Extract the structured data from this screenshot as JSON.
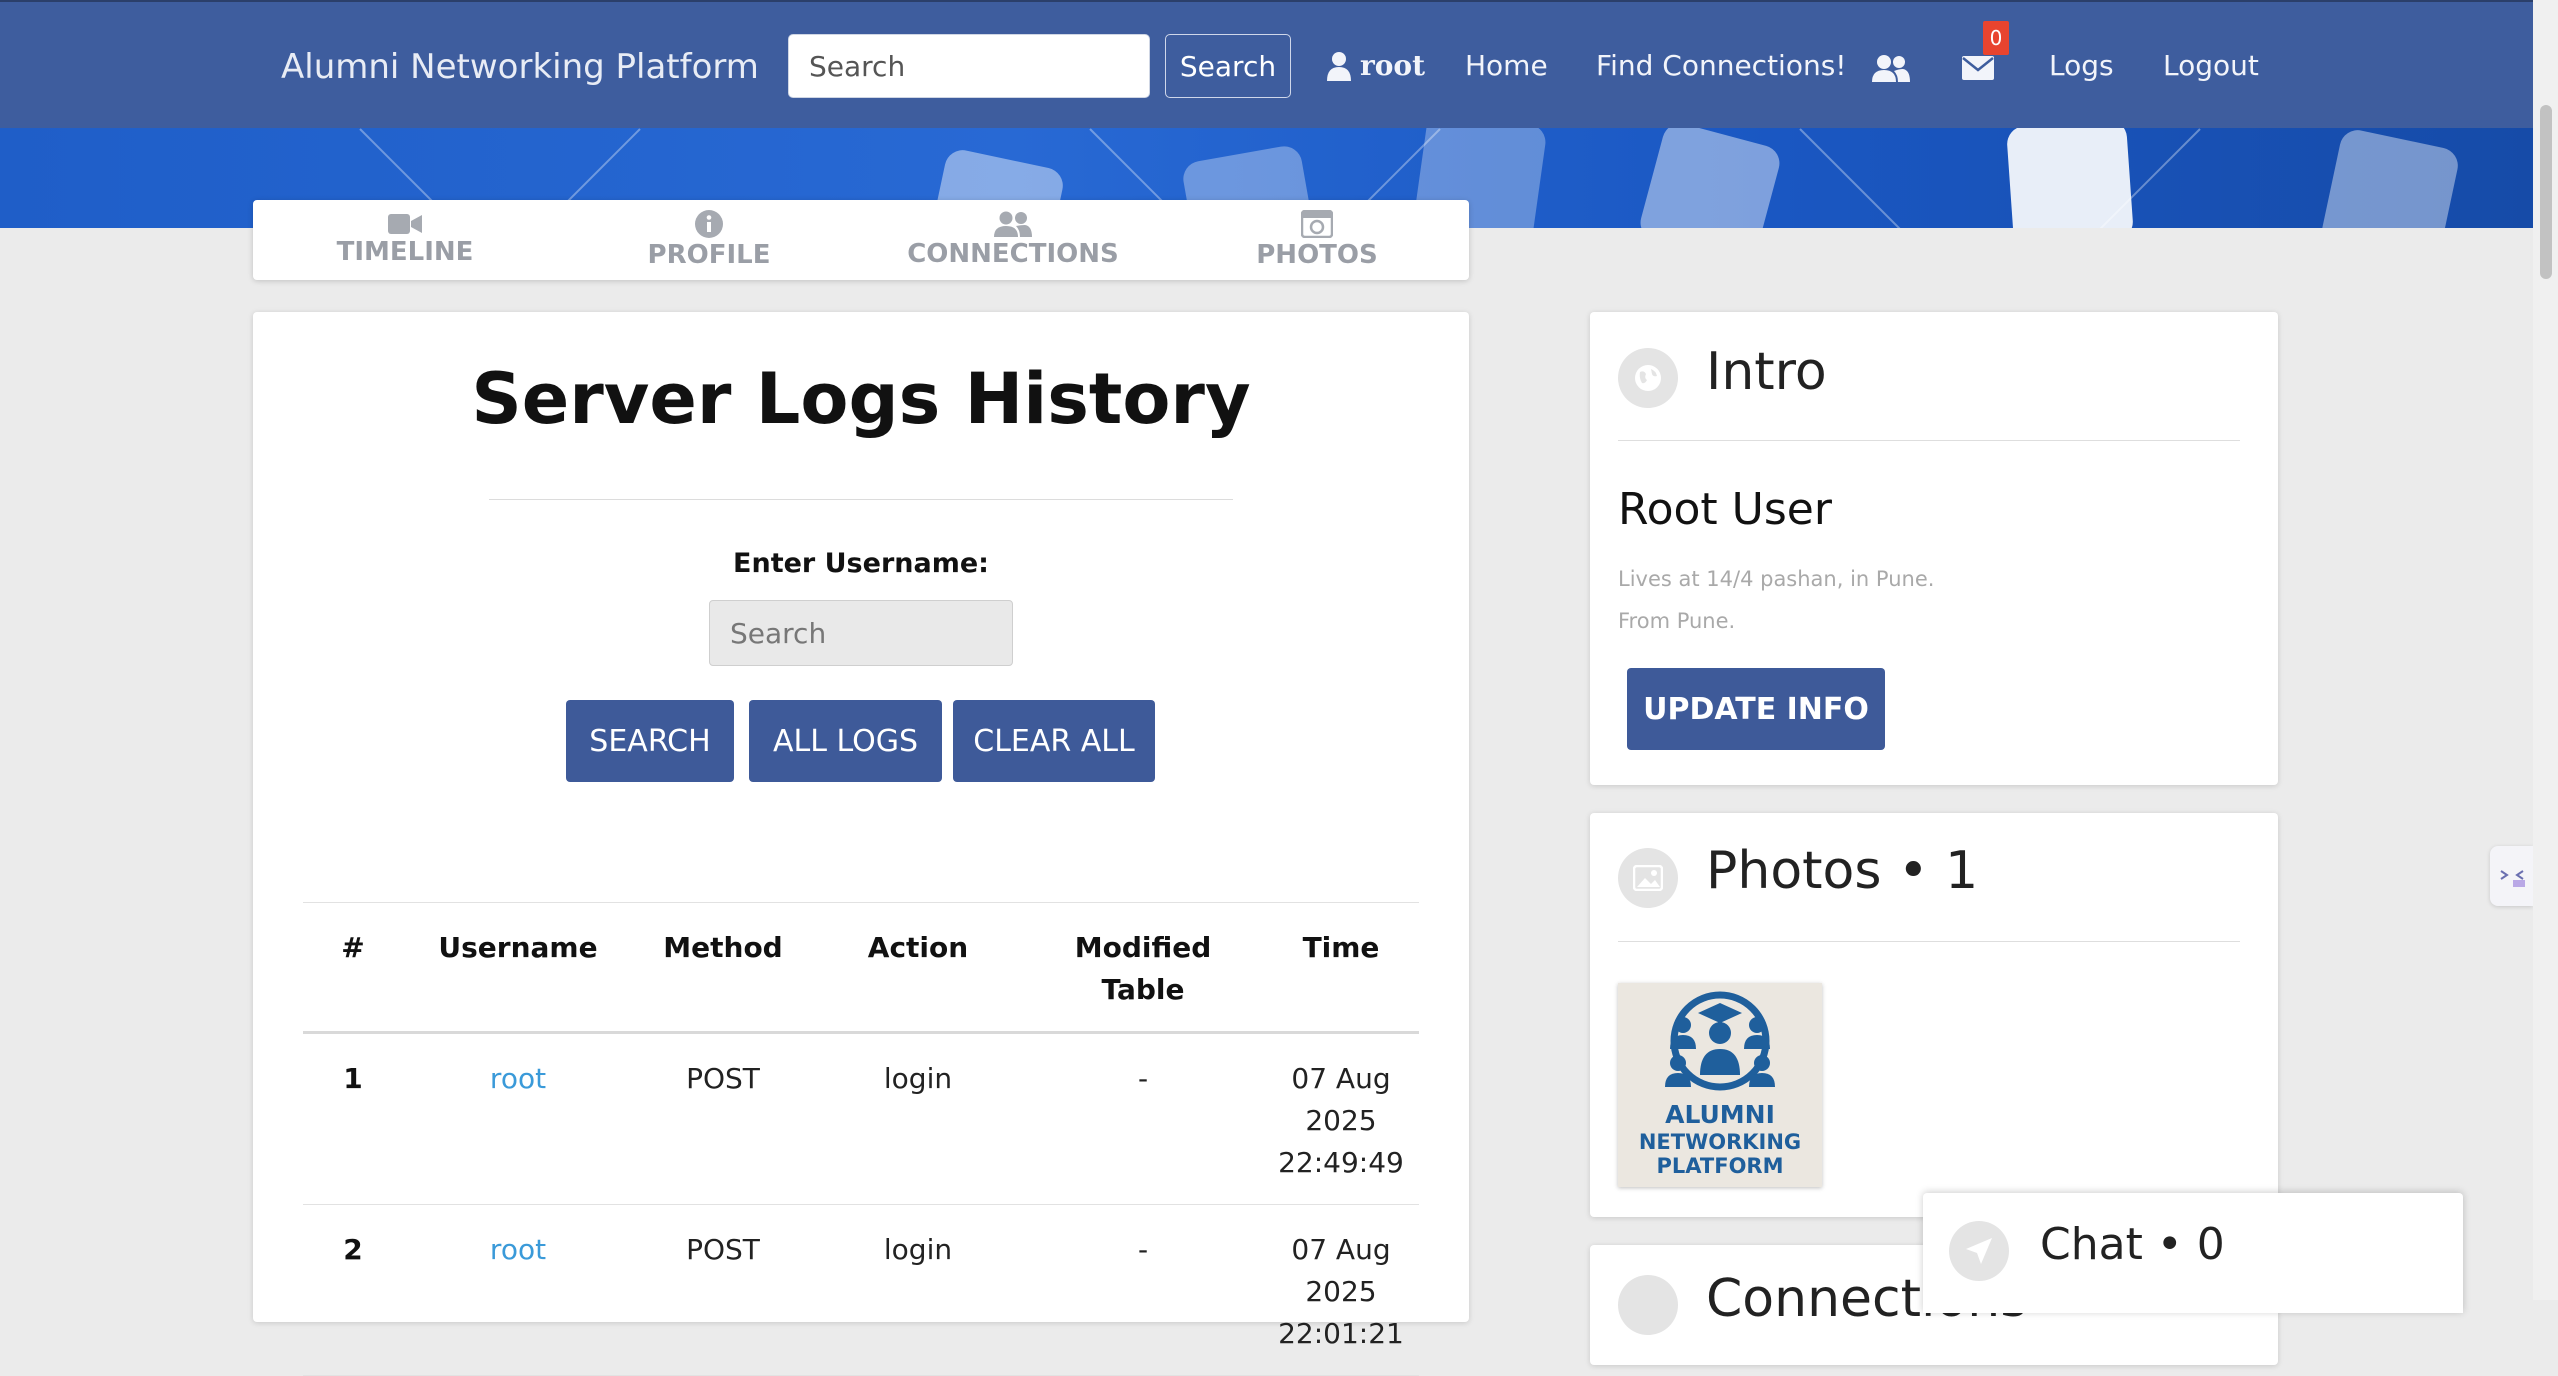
{
  "navbar": {
    "brand": "Alumni Networking Platform",
    "search_placeholder": "Search",
    "search_button": "Search",
    "user": "root",
    "home": "Home",
    "find_connections": "Find Connections!",
    "messages_badge": "0",
    "logs": "Logs",
    "logout": "Logout"
  },
  "tabs": [
    {
      "label": "TIMELINE",
      "icon": "video-camera-icon"
    },
    {
      "label": "PROFILE",
      "icon": "info-circle-icon"
    },
    {
      "label": "CONNECTIONS",
      "icon": "users-icon"
    },
    {
      "label": "PHOTOS",
      "icon": "camera-icon"
    }
  ],
  "main": {
    "title": "Server Logs History",
    "username_label": "Enter Username:",
    "search_placeholder": "Search",
    "buttons": {
      "search": "SEARCH",
      "all_logs": "ALL LOGS",
      "clear_all": "CLEAR ALL"
    },
    "table": {
      "headers": [
        "#",
        "Username",
        "Method",
        "Action",
        "Modified Table",
        "Time"
      ],
      "rows": [
        {
          "idx": "1",
          "username": "root",
          "method": "POST",
          "action": "login",
          "table": "-",
          "date": "07 Aug 2025",
          "time": "22:49:49"
        },
        {
          "idx": "2",
          "username": "root",
          "method": "POST",
          "action": "login",
          "table": "-",
          "date": "07 Aug 2025",
          "time": "22:01:21"
        }
      ]
    }
  },
  "intro": {
    "heading": "Intro",
    "name": "Root User",
    "lives": "Lives at 14/4 pashan, in Pune.",
    "from": "From Pune.",
    "update_button": "UPDATE INFO"
  },
  "photos": {
    "heading": "Photos • 1",
    "logo_text": [
      "ALUMNI",
      "NETWORKING",
      "PLATFORM"
    ]
  },
  "connections": {
    "heading": "Connections"
  },
  "chat": {
    "heading": "Chat • 0"
  },
  "colors": {
    "navbar": "#3e5d9e",
    "button": "#3e5a99",
    "link": "#3a9ad9",
    "badge": "#e8442f",
    "logo_blue": "#1f5f9c"
  }
}
